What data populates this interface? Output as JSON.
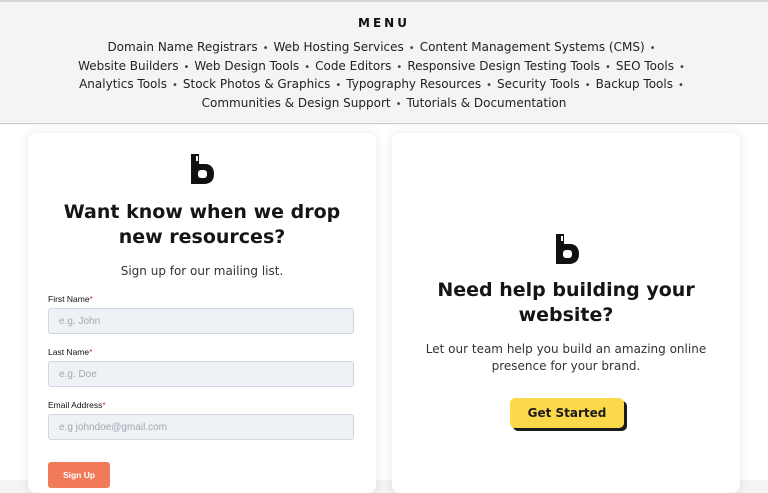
{
  "menu": {
    "title": "MENU",
    "links": [
      [
        "Domain Name Registrars",
        "Web Hosting Services",
        "Content Management Systems (CMS)"
      ],
      [
        "Website Builders",
        "Web Design Tools",
        "Code Editors",
        "Responsive Design Testing Tools",
        "SEO Tools"
      ],
      [
        "Analytics Tools",
        "Stock Photos & Graphics",
        "Typography Resources",
        "Security Tools",
        "Backup Tools"
      ],
      [
        "Communities & Design Support",
        "Tutorials & Documentation"
      ]
    ],
    "separator": "•"
  },
  "signup_card": {
    "logo_icon": "brand-b-logo-icon",
    "heading_line1": "Want know when we drop",
    "heading_line2": "new resources?",
    "subtext": "Sign up for our mailing list.",
    "required_mark": "*",
    "fields": {
      "first_name": {
        "label": "First Name",
        "placeholder": "e.g. John",
        "value": ""
      },
      "last_name": {
        "label": "Last Name",
        "placeholder": "e.g. Doe",
        "value": ""
      },
      "email": {
        "label": "Email Address",
        "placeholder": "e.g johndoe@gmail.com",
        "value": ""
      }
    },
    "submit_label": "Sign Up"
  },
  "help_card": {
    "logo_icon": "brand-b-logo-icon",
    "heading_line1": "Need help building your",
    "heading_line2": "website?",
    "subtext_line1": "Let our team help you build an amazing online",
    "subtext_line2": "presence for your brand.",
    "cta_label": "Get Started"
  },
  "colors": {
    "accent_yellow": "#fcd94b",
    "signup_orange": "#f07a5a",
    "required_red": "#d93b2b",
    "input_bg": "#eef1f5"
  }
}
